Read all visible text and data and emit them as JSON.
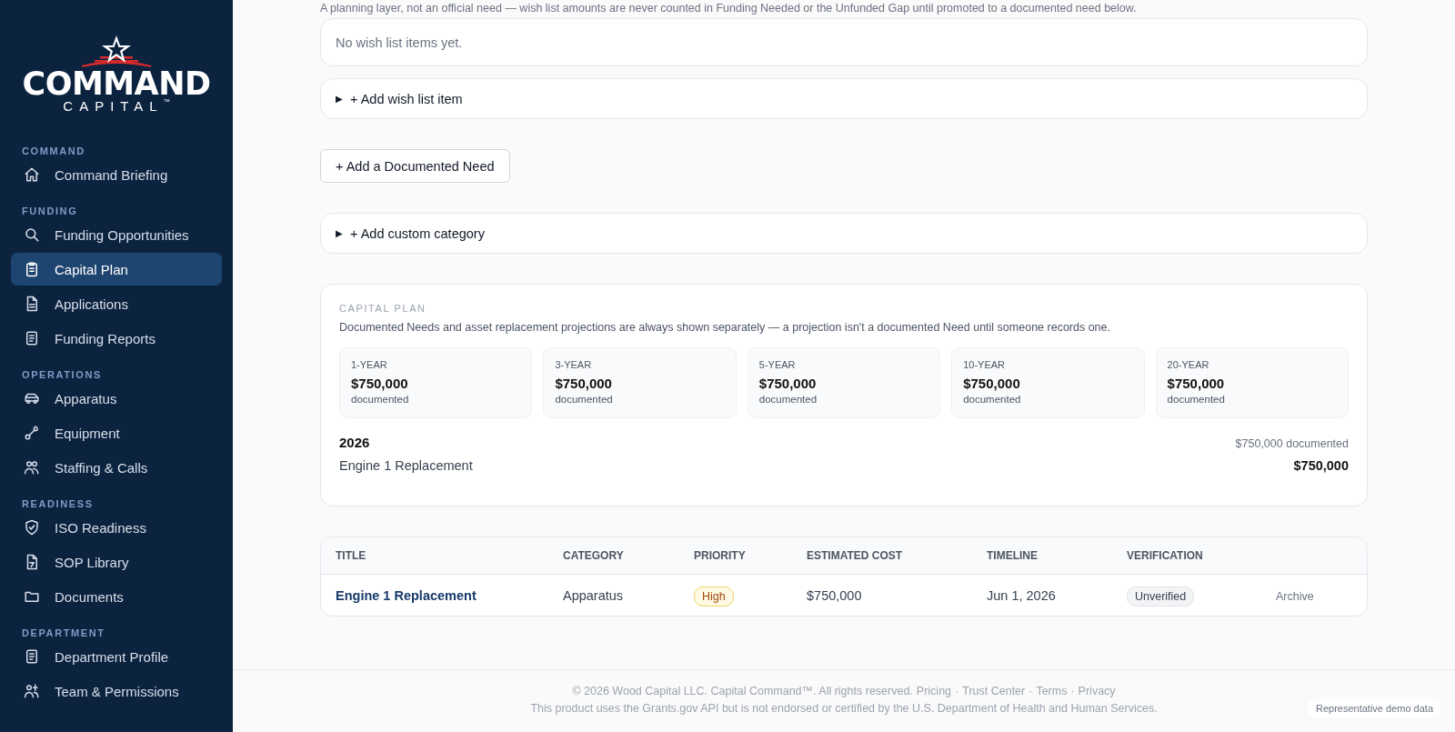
{
  "sidebar": {
    "logo": {
      "wordmark": "COMMAND",
      "subtitle": "CAPITAL",
      "trademark": "™"
    },
    "sections": [
      {
        "heading": "COMMAND",
        "items": [
          {
            "label": "Command Briefing",
            "kind": "home",
            "selected": false
          }
        ]
      },
      {
        "heading": "FUNDING",
        "items": [
          {
            "label": "Funding Opportunities",
            "kind": "search",
            "selected": false
          },
          {
            "label": "Capital Plan",
            "kind": "clipboard",
            "selected": true
          },
          {
            "label": "Applications",
            "kind": "file",
            "selected": false
          },
          {
            "label": "Funding Reports",
            "kind": "report",
            "selected": false
          }
        ]
      },
      {
        "heading": "OPERATIONS",
        "items": [
          {
            "label": "Apparatus",
            "kind": "truck",
            "selected": false
          },
          {
            "label": "Equipment",
            "kind": "tool",
            "selected": false
          },
          {
            "label": "Staffing & Calls",
            "kind": "people",
            "selected": false
          }
        ]
      },
      {
        "heading": "READINESS",
        "items": [
          {
            "label": "ISO Readiness",
            "kind": "shield",
            "selected": false
          },
          {
            "label": "SOP Library",
            "kind": "doc",
            "selected": false
          },
          {
            "label": "Documents",
            "kind": "folder",
            "selected": false
          }
        ]
      },
      {
        "heading": "DEPARTMENT",
        "items": [
          {
            "label": "Department Profile",
            "kind": "report",
            "selected": false
          },
          {
            "label": "Team & Permissions",
            "kind": "team",
            "selected": false
          }
        ]
      }
    ]
  },
  "main": {
    "intro_note": "A planning layer, not an official need — wish list amounts are never counted in Funding Needed or the Unfunded Gap until promoted to a documented need below.",
    "wish_list_empty": "No wish list items yet.",
    "add_wish_list": {
      "marker": "▶",
      "label": "+ Add wish list item",
      "expanded": false
    },
    "add_need_button": "+ Add a Documented Need",
    "add_category": {
      "marker": "▶",
      "label": "+ Add custom category",
      "expanded": false
    },
    "capital_plan": {
      "heading": "CAPITAL PLAN",
      "description": "Documented Needs and asset replacement projections are always shown separately — a projection isn't a documented Need until someone records one.",
      "horizons": [
        {
          "label": "1-YEAR",
          "amount": "$750,000",
          "note": "documented"
        },
        {
          "label": "3-YEAR",
          "amount": "$750,000",
          "note": "documented"
        },
        {
          "label": "5-YEAR",
          "amount": "$750,000",
          "note": "documented"
        },
        {
          "label": "10-YEAR",
          "amount": "$750,000",
          "note": "documented"
        },
        {
          "label": "20-YEAR",
          "amount": "$750,000",
          "note": "documented"
        }
      ],
      "years": [
        {
          "year": "2026",
          "total": "$750,000 documented",
          "items": [
            {
              "title": "Engine 1 Replacement",
              "amount": "$750,000"
            }
          ]
        }
      ]
    },
    "needs_table": {
      "columns": [
        "TITLE",
        "CATEGORY",
        "PRIORITY",
        "ESTIMATED COST",
        "TIMELINE",
        "VERIFICATION"
      ],
      "rows": [
        {
          "title": "Engine 1 Replacement",
          "category": "Apparatus",
          "priority": "High",
          "estimated_cost": "$750,000",
          "timeline": "Jun 1, 2026",
          "verification": "Unverified",
          "action": "Archive"
        }
      ]
    }
  },
  "footer": {
    "copyright": "© 2026 Wood Capital LLC. Capital Command™. All rights reserved.",
    "separator": "·",
    "links": [
      "Pricing",
      "Trust Center",
      "Terms",
      "Privacy"
    ],
    "disclaimer": "This product uses the Grants.gov API but is not endorsed or certified by the U.S. Department of Health and Human Services.",
    "demo_badge": "Representative demo data"
  }
}
